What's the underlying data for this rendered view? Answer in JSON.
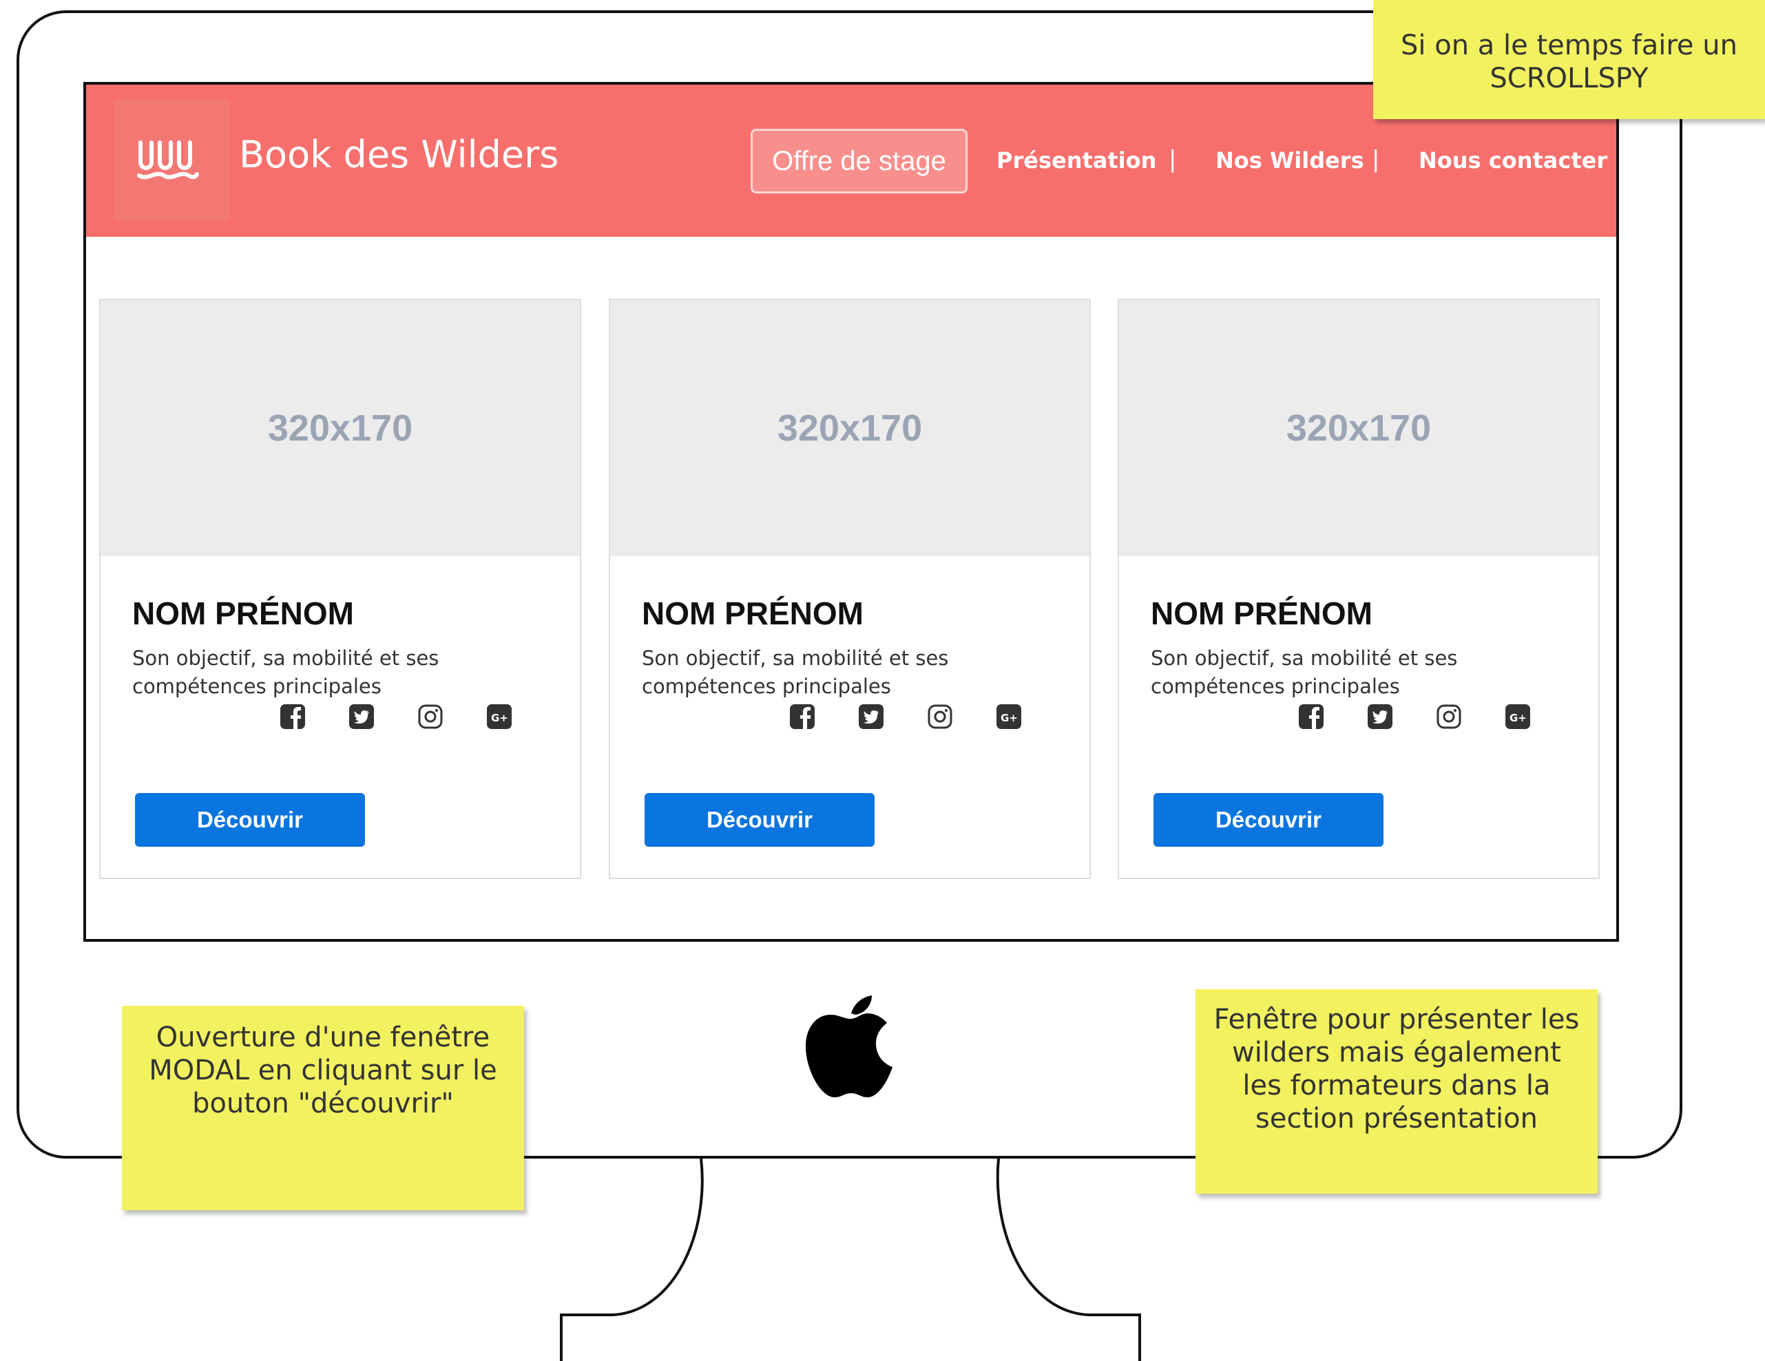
{
  "navbar": {
    "brand": "Book des Wilders",
    "offer_button": "Offre de stage",
    "links": [
      "Présentation",
      "Nos Wilders",
      "Nous contacter"
    ],
    "separator": "|",
    "colors": {
      "background": "#f66f6c",
      "logo_box": "#f37873"
    }
  },
  "cards": [
    {
      "image_placeholder": "320x170",
      "name": "NOM PRÉNOM",
      "description": "Son objectif, sa mobilité et ses compétences principales",
      "social_icons": [
        "facebook-icon",
        "twitter-icon",
        "instagram-icon",
        "google-plus-icon"
      ],
      "button": "Découvrir"
    },
    {
      "image_placeholder": "320x170",
      "name": "NOM PRÉNOM",
      "description": "Son objectif, sa mobilité et ses compétences principales",
      "social_icons": [
        "facebook-icon",
        "twitter-icon",
        "instagram-icon",
        "google-plus-icon"
      ],
      "button": "Découvrir"
    },
    {
      "image_placeholder": "320x170",
      "name": "NOM PRÉNOM",
      "description": "Son objectif, sa mobilité et ses compétences principales",
      "social_icons": [
        "facebook-icon",
        "twitter-icon",
        "instagram-icon",
        "google-plus-icon"
      ],
      "button": "Découvrir"
    }
  ],
  "notes": {
    "top": [
      "Si on a le temps faire un",
      "SCROLLSPY"
    ],
    "left": [
      "Ouverture d'une fenêtre",
      "MODAL en cliquant sur le",
      "bouton \"découvrir\""
    ],
    "right": [
      "Fenêtre pour présenter les",
      "wilders mais également",
      "les formateurs dans la",
      "section présentation"
    ]
  },
  "colors": {
    "accent_button": "#0a75df",
    "sticky_note": "#f2f260"
  }
}
